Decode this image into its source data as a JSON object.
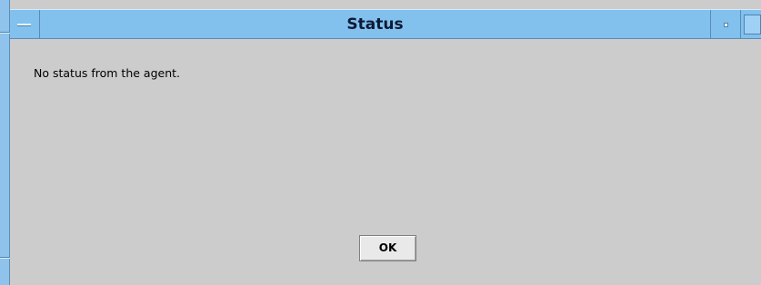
{
  "window": {
    "title": "Status",
    "message": "No status from the agent.",
    "ok_label": "OK"
  },
  "icons": {
    "window_menu": "window-menu-icon",
    "minimize": "minimize-icon",
    "maximize": "maximize-icon"
  },
  "colors": {
    "titlebar": "#82c0ee",
    "frame": "#8fc3ec",
    "dialog_background": "#cccccc",
    "title_text": "#0d1a33"
  }
}
